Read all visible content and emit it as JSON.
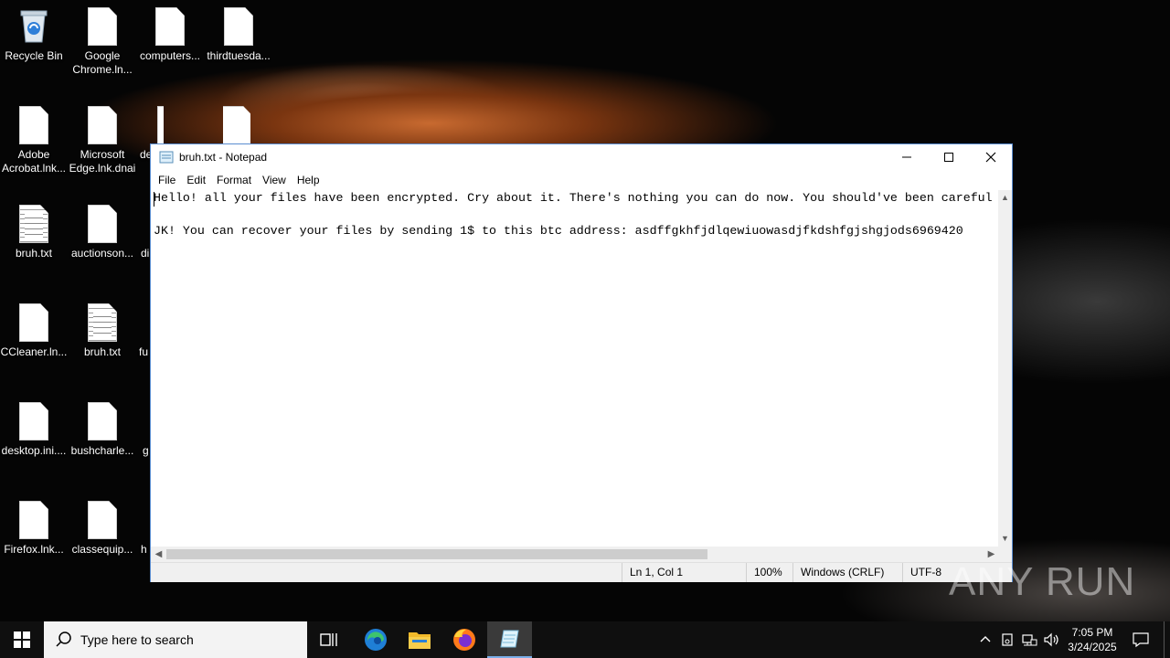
{
  "desktop": {
    "icons": [
      {
        "label": "Recycle Bin"
      },
      {
        "label": "Google Chrome.ln..."
      },
      {
        "label": "computers..."
      },
      {
        "label": "thirdtuesda..."
      },
      {
        "label": "Adobe Acrobat.lnk..."
      },
      {
        "label": "Microsoft Edge.lnk.dnai"
      },
      {
        "label": "de"
      },
      {
        "label": "bruh.txt"
      },
      {
        "label": "auctionson..."
      },
      {
        "label": "di"
      },
      {
        "label": "CCleaner.ln..."
      },
      {
        "label": "bruh.txt"
      },
      {
        "label": "fu"
      },
      {
        "label": "desktop.ini...."
      },
      {
        "label": "bushcharle..."
      },
      {
        "label": "g"
      },
      {
        "label": "Firefox.lnk..."
      },
      {
        "label": "classequip..."
      },
      {
        "label": "h"
      }
    ]
  },
  "window": {
    "title": "bruh.txt - Notepad",
    "menu": [
      "File",
      "Edit",
      "Format",
      "View",
      "Help"
    ],
    "content_lines": [
      "Hello! all your files have been encrypted. Cry about it. There's nothing you can do now. You should've been careful",
      "",
      "JK! You can recover your files by sending 1$ to this btc address: asdffgkhfjdlqewiuowasdjfkdshfgjshgjods6969420"
    ],
    "status": {
      "position": "Ln 1, Col 1",
      "zoom": "100%",
      "line_endings": "Windows (CRLF)",
      "encoding": "UTF-8"
    }
  },
  "watermark": "ANY RUN",
  "taskbar": {
    "search_placeholder": "Type here to search",
    "time": "7:05 PM",
    "date": "3/24/2025"
  },
  "colors": {
    "taskbar_bg": "#0f0f0f",
    "accent": "#7aaee8",
    "window_border": "#5a8dd0"
  }
}
